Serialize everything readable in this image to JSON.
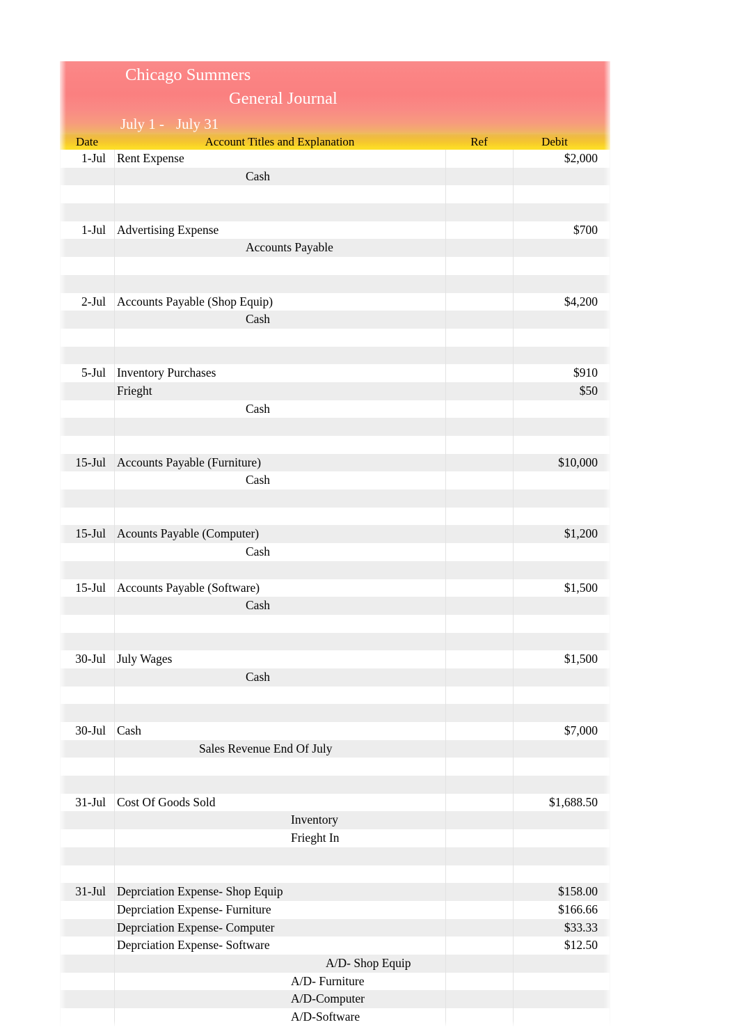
{
  "document": {
    "company": "Chicago Summers",
    "title": "General Journal",
    "period_start": "July 1 -",
    "period_end": "July 31"
  },
  "colors": {
    "banner_top": "#fa8a8a",
    "banner_bottom": "#f98080",
    "header_gold_top": "#edb94e",
    "header_gold_bottom": "#fde12a",
    "highlight_text": "#ff0000",
    "body_text": "#000000",
    "row_band": "#ededed"
  },
  "columns": {
    "date": "Date",
    "titles": "Account Titles and Explanation",
    "ref": "Ref",
    "debit": "Debit"
  },
  "rows": [
    {
      "date": "1-Jul",
      "account": "Rent Expense",
      "indent": 0,
      "ref": "",
      "debit": "$2,000",
      "red": false
    },
    {
      "date": "",
      "account": "Cash",
      "indent": 3,
      "ref": "",
      "debit": "",
      "red": false
    },
    {
      "date": "",
      "account": "",
      "indent": 0,
      "ref": "",
      "debit": "",
      "red": false
    },
    {
      "date": "",
      "account": "",
      "indent": 0,
      "ref": "",
      "debit": "",
      "red": false
    },
    {
      "date": "1-Jul",
      "account": "Advertising Expense",
      "indent": 0,
      "ref": "",
      "debit": "$700",
      "red": true
    },
    {
      "date": "",
      "account": "Accounts Payable",
      "indent": 3,
      "ref": "",
      "debit": "",
      "red": false
    },
    {
      "date": "",
      "account": "",
      "indent": 0,
      "ref": "",
      "debit": "",
      "red": false
    },
    {
      "date": "",
      "account": "",
      "indent": 0,
      "ref": "",
      "debit": "",
      "red": false
    },
    {
      "date": "2-Jul",
      "account": "Accounts Payable (Shop Equip)",
      "indent": 0,
      "ref": "",
      "debit": "$4,200",
      "red": false
    },
    {
      "date": "",
      "account": "Cash",
      "indent": 3,
      "ref": "",
      "debit": "",
      "red": false
    },
    {
      "date": "",
      "account": "",
      "indent": 0,
      "ref": "",
      "debit": "",
      "red": false
    },
    {
      "date": "",
      "account": "",
      "indent": 0,
      "ref": "",
      "debit": "",
      "red": false
    },
    {
      "date": "5-Jul",
      "account": "Inventory Purchases",
      "indent": 0,
      "ref": "",
      "debit": "$910",
      "red": false
    },
    {
      "date": "",
      "account": "Frieght",
      "indent": 0,
      "ref": "",
      "debit": "$50",
      "red": true
    },
    {
      "date": "",
      "account": "Cash",
      "indent": 3,
      "ref": "",
      "debit": "",
      "red": false
    },
    {
      "date": "",
      "account": "",
      "indent": 0,
      "ref": "",
      "debit": "",
      "red": false
    },
    {
      "date": "",
      "account": "",
      "indent": 0,
      "ref": "",
      "debit": "",
      "red": false
    },
    {
      "date": "15-Jul",
      "account": "Accounts Payable (Furniture)",
      "indent": 0,
      "ref": "",
      "debit": "$10,000",
      "red": false
    },
    {
      "date": "",
      "account": "Cash",
      "indent": 3,
      "ref": "",
      "debit": "",
      "red": false
    },
    {
      "date": "",
      "account": "",
      "indent": 0,
      "ref": "",
      "debit": "",
      "red": false
    },
    {
      "date": "",
      "account": "",
      "indent": 0,
      "ref": "",
      "debit": "",
      "red": false
    },
    {
      "date": "15-Jul",
      "account": "Acounts Payable (Computer)",
      "indent": 0,
      "ref": "",
      "debit": "$1,200",
      "red": false
    },
    {
      "date": "",
      "account": "Cash",
      "indent": 3,
      "ref": "",
      "debit": "",
      "red": false
    },
    {
      "date": "",
      "account": "",
      "indent": 0,
      "ref": "",
      "debit": "",
      "red": false
    },
    {
      "date": "15-Jul",
      "account": "Accounts Payable (Software)",
      "indent": 0,
      "ref": "",
      "debit": "$1,500",
      "red": false
    },
    {
      "date": "",
      "account": "Cash",
      "indent": 3,
      "ref": "",
      "debit": "",
      "red": false
    },
    {
      "date": "",
      "account": "",
      "indent": 0,
      "ref": "",
      "debit": "",
      "red": false
    },
    {
      "date": "",
      "account": "",
      "indent": 0,
      "ref": "",
      "debit": "",
      "red": false
    },
    {
      "date": "30-Jul",
      "account": "July Wages",
      "indent": 0,
      "ref": "",
      "debit": "$1,500",
      "red": true
    },
    {
      "date": "",
      "account": "Cash",
      "indent": 3,
      "ref": "",
      "debit": "",
      "red": false
    },
    {
      "date": "",
      "account": "",
      "indent": 0,
      "ref": "",
      "debit": "",
      "red": false
    },
    {
      "date": "",
      "account": "",
      "indent": 0,
      "ref": "",
      "debit": "",
      "red": false
    },
    {
      "date": "30-Jul",
      "account": "Cash",
      "indent": 0,
      "ref": "",
      "debit": "$7,000",
      "red": false
    },
    {
      "date": "",
      "account": "Sales Revenue End Of July",
      "indent": 2,
      "ref": "",
      "debit": "",
      "red": true
    },
    {
      "date": "",
      "account": "",
      "indent": 0,
      "ref": "",
      "debit": "",
      "red": false
    },
    {
      "date": "",
      "account": "",
      "indent": 0,
      "ref": "",
      "debit": "",
      "red": false
    },
    {
      "date": "31-Jul",
      "account": "Cost Of Goods Sold",
      "indent": 0,
      "ref": "",
      "debit": "$1,688.50",
      "red": false
    },
    {
      "date": "",
      "account": "Inventory",
      "indent": 4,
      "ref": "",
      "debit": "",
      "red": false
    },
    {
      "date": "",
      "account": "Frieght In",
      "indent": 4,
      "ref": "",
      "debit": "",
      "red": false
    },
    {
      "date": "",
      "account": "",
      "indent": 0,
      "ref": "",
      "debit": "",
      "red": false
    },
    {
      "date": "",
      "account": "",
      "indent": 0,
      "ref": "",
      "debit": "",
      "red": false
    },
    {
      "date": "31-Jul",
      "account": "Deprciation Expense- Shop Equip",
      "indent": 0,
      "ref": "",
      "debit": "$158.00",
      "red": false
    },
    {
      "date": "",
      "account": "Deprciation Expense- Furniture",
      "indent": 0,
      "ref": "",
      "debit": "$166.66",
      "red": false
    },
    {
      "date": "",
      "account": "Deprciation Expense- Computer",
      "indent": 0,
      "ref": "",
      "debit": "$33.33",
      "red": false
    },
    {
      "date": "",
      "account": "Deprciation Expense- Software",
      "indent": 0,
      "ref": "",
      "debit": "$12.50",
      "red": false
    },
    {
      "date": "",
      "account": "A/D- Shop Equip",
      "indent": 5,
      "ref": "",
      "debit": "",
      "red": false
    },
    {
      "date": "",
      "account": "A/D- Furniture",
      "indent": 4,
      "ref": "",
      "debit": "",
      "red": false
    },
    {
      "date": "",
      "account": "A/D-Computer",
      "indent": 4,
      "ref": "",
      "debit": "",
      "red": false
    },
    {
      "date": "",
      "account": "A/D-Software",
      "indent": 4,
      "ref": "",
      "debit": "",
      "red": false
    }
  ]
}
